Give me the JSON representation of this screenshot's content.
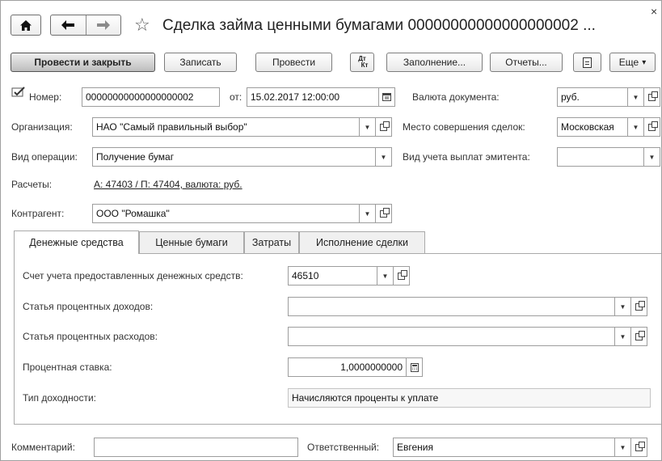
{
  "window": {
    "title": "Сделка займа ценными бумагами 00000000000000000002 ...",
    "close_glyph": "×",
    "home_icon": "home-icon",
    "back_icon": "arrow-left-icon",
    "forward_icon": "arrow-right-icon",
    "favorite_icon": "star-icon"
  },
  "toolbar": {
    "post_close": "Провести и закрыть",
    "save": "Записать",
    "post": "Провести",
    "dtkt_top": "Дт",
    "dtkt_bottom": "Кт",
    "fill": "Заполнение...",
    "reports": "Отчеты...",
    "more": "Еще"
  },
  "header": {
    "number_label": "Номер:",
    "number_value": "00000000000000000002",
    "date_label": "от:",
    "date_value": "15.02.2017 12:00:00",
    "currency_label": "Валюта документа:",
    "currency_value": "руб.",
    "org_label": "Организация:",
    "org_value": "НАО \"Самый правильный выбор\"",
    "place_label": "Место совершения сделок:",
    "place_value": "Московская",
    "operation_label": "Вид операции:",
    "operation_value": "Получение бумаг",
    "issuer_label": "Вид учета выплат эмитента:",
    "issuer_value": "",
    "settlements_label": "Расчеты:",
    "settlements_link": "А: 47403 / П: 47404, валюта: руб.",
    "counterparty_label": "Контрагент:",
    "counterparty_value": "ООО \"Ромашка\""
  },
  "tabs": [
    {
      "label": "Денежные средства",
      "active": true
    },
    {
      "label": "Ценные бумаги",
      "active": false
    },
    {
      "label": "Затраты",
      "active": false
    },
    {
      "label": "Исполнение сделки",
      "active": false
    }
  ],
  "money_tab": {
    "account_label": "Счет учета предоставленных денежных средств:",
    "account_value": "46510",
    "income_label": "Статья процентных доходов:",
    "income_value": "",
    "expense_label": "Статья процентных расходов:",
    "expense_value": "",
    "rate_label": "Процентная ставка:",
    "rate_value": "1,0000000000",
    "yield_label": "Тип доходности:",
    "yield_value": "Начисляются проценты к уплате"
  },
  "footer": {
    "comment_label": "Комментарий:",
    "comment_value": "",
    "responsible_label": "Ответственный:",
    "responsible_value": "Евгения"
  },
  "glyphs": {
    "dropdown": "▼",
    "more_arrow": "▾"
  }
}
